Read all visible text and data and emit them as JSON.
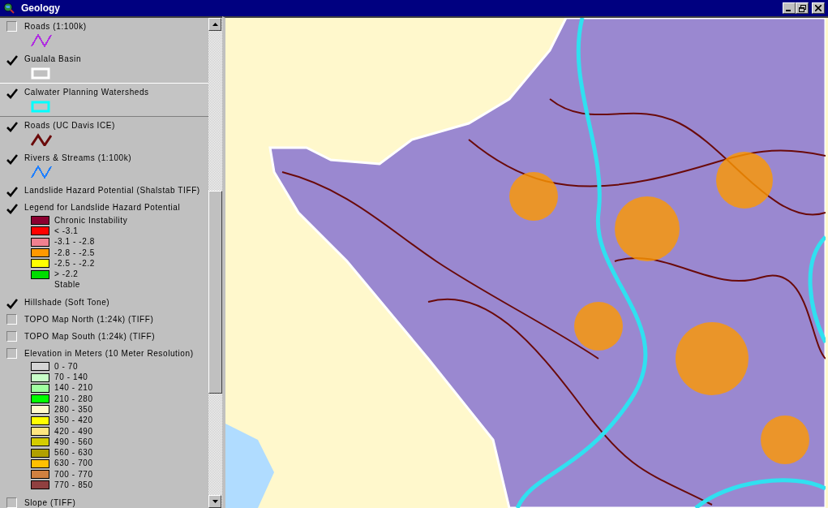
{
  "window": {
    "title": "Geology"
  },
  "layers": [
    {
      "name": "Roads (1:100k)",
      "checked": false,
      "selected": false,
      "symbol": {
        "kind": "line",
        "color": "#b030e0"
      }
    },
    {
      "name": "Gualala Basin",
      "checked": true,
      "selected": false,
      "symbol": {
        "kind": "outline",
        "color": "#ffffff"
      }
    },
    {
      "name": "Calwater Planning Watersheds",
      "checked": true,
      "selected": true,
      "symbol": {
        "kind": "outline",
        "color": "#00ffff"
      }
    },
    {
      "name": "Roads (UC Davis ICE)",
      "checked": true,
      "selected": false,
      "symbol": {
        "kind": "thick-line",
        "color": "#6a0a0a"
      }
    },
    {
      "name": "Rivers & Streams (1:100k)",
      "checked": true,
      "selected": false,
      "symbol": {
        "kind": "line",
        "color": "#2080ff"
      }
    },
    {
      "name": "Landslide Hazard Potential (Shalstab TIFF)",
      "checked": true,
      "selected": false
    },
    {
      "name": "Legend for Landslide Hazard Potential",
      "checked": true,
      "selected": false,
      "classes": [
        {
          "label": "Chronic Instability",
          "color": "#8b0030"
        },
        {
          "label": "<  -3.1",
          "color": "#ff0000"
        },
        {
          "label": "-3.1 - -2.8",
          "color": "#f08090"
        },
        {
          "label": "-2.8 - -2.5",
          "color": "#ff9900"
        },
        {
          "label": "-2.5 - -2.2",
          "color": "#ffff00"
        },
        {
          "label": "> -2.2",
          "color": "#00dd00"
        },
        {
          "label": "Stable"
        }
      ]
    },
    {
      "name": "Hillshade (Soft Tone)",
      "checked": true,
      "selected": false
    },
    {
      "name": "TOPO Map North (1:24k) (TIFF)",
      "checked": false,
      "selected": false
    },
    {
      "name": "TOPO Map South (1:24k) (TIFF)",
      "checked": false,
      "selected": false
    },
    {
      "name": "Elevation in Meters (10 Meter Resolution)",
      "checked": false,
      "selected": false,
      "classes": [
        {
          "label": "0 - 70",
          "color": "#d4d4d4"
        },
        {
          "label": "70 -  140",
          "color": "#c8ffc8"
        },
        {
          "label": "140 - 210",
          "color": "#a0ffa0"
        },
        {
          "label": "210 - 280",
          "color": "#00ff00"
        },
        {
          "label": "280 - 350",
          "color": "#fffacc"
        },
        {
          "label": "350 - 420",
          "color": "#ffff00"
        },
        {
          "label": "420 - 490",
          "color": "#ffe680"
        },
        {
          "label": "490 - 560",
          "color": "#d4cc00"
        },
        {
          "label": "560 - 630",
          "color": "#b0a000"
        },
        {
          "label": "630 - 700",
          "color": "#ffc000"
        },
        {
          "label": "700 - 770",
          "color": "#d08040"
        },
        {
          "label": "770 - 850",
          "color": "#904040"
        }
      ]
    },
    {
      "name": "Slope (TIFF)",
      "checked": false,
      "selected": false
    }
  ]
}
